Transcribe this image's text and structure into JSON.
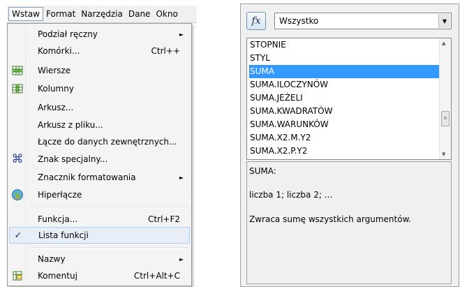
{
  "menubar": {
    "items": [
      "Wstaw",
      "Format",
      "Narzędzia",
      "Dane",
      "Okno"
    ]
  },
  "menu": {
    "items": [
      {
        "label": "Podział ręczny",
        "shortcut": "",
        "submenu": true,
        "icon": ""
      },
      {
        "label": "Komórki...",
        "shortcut": "Ctrl++",
        "submenu": false,
        "icon": ""
      },
      {
        "label": "Wiersze",
        "shortcut": "",
        "submenu": false,
        "icon": "insert-rows-icon"
      },
      {
        "label": "Kolumny",
        "shortcut": "",
        "submenu": false,
        "icon": "insert-columns-icon"
      },
      {
        "label": "Arkusz...",
        "shortcut": "",
        "submenu": false,
        "icon": ""
      },
      {
        "label": "Arkusz z pliku...",
        "shortcut": "",
        "submenu": false,
        "icon": ""
      },
      {
        "label": "Łącze do danych zewnętrznych...",
        "shortcut": "",
        "submenu": false,
        "icon": ""
      },
      {
        "label": "Znak specjalny...",
        "shortcut": "",
        "submenu": false,
        "icon": "special-character-icon"
      },
      {
        "label": "Znacznik formatowania",
        "shortcut": "",
        "submenu": true,
        "icon": ""
      },
      {
        "label": "Hiperłącze",
        "shortcut": "",
        "submenu": false,
        "icon": "hyperlink-icon"
      },
      {
        "label": "Funkcja...",
        "shortcut": "Ctrl+F2",
        "submenu": false,
        "icon": ""
      },
      {
        "label": "Lista funkcji",
        "shortcut": "",
        "submenu": false,
        "icon": "checkmark-icon",
        "checked": true
      },
      {
        "label": "Nazwy",
        "shortcut": "",
        "submenu": true,
        "icon": ""
      },
      {
        "label": "Komentuj",
        "shortcut": "Ctrl+Alt+C",
        "submenu": false,
        "icon": "comment-icon"
      }
    ]
  },
  "functions": {
    "fx_label": "fx",
    "category": "Wszystko",
    "list": [
      "STOPNIE",
      "STYL",
      "SUMA",
      "SUMA.ILOCZYNÓW",
      "SUMA.JEŻELI",
      "SUMA.KWADRATÓW",
      "SUMA.WARUNKÓW",
      "SUMA.X2.M.Y2",
      "SUMA.X2.P.Y2"
    ],
    "selected": "SUMA",
    "description": {
      "name": "SUMA:",
      "syntax": "liczba 1; liczba 2; ...",
      "text": "Zwraca sumę wszystkich argumentów."
    }
  },
  "colors": {
    "selection": "#3399ff",
    "check_highlight": "#e8eef7"
  }
}
